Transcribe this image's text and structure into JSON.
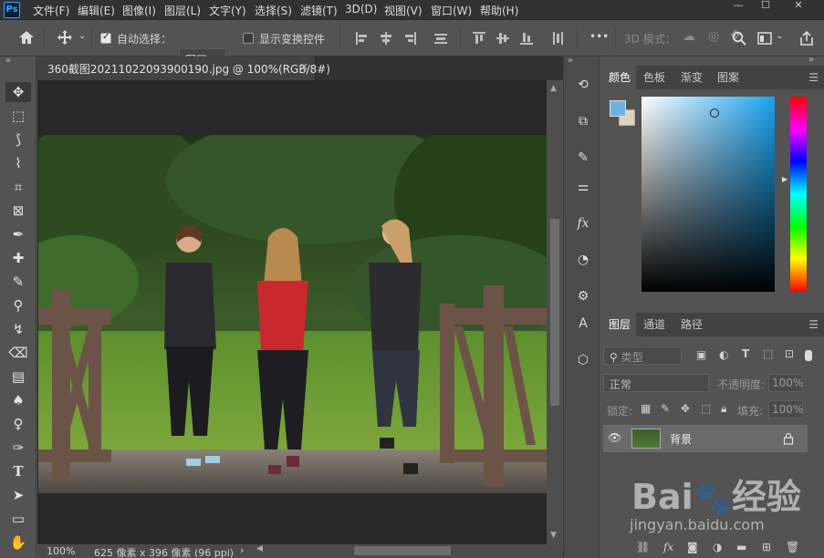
{
  "app": {
    "logo": "Ps"
  },
  "menu": [
    "文件(F)",
    "编辑(E)",
    "图像(I)",
    "图层(L)",
    "文字(Y)",
    "选择(S)",
    "滤镜(T)",
    "3D(D)",
    "视图(V)",
    "窗口(W)",
    "帮助(H)"
  ],
  "window_controls": {
    "minimize": "—",
    "maximize": "☐",
    "close": "✕"
  },
  "options": {
    "auto_select_label": "自动选择：",
    "auto_select_checked": true,
    "auto_select_target": "图层",
    "show_transform_label": "显示变换控件",
    "show_transform_checked": false,
    "more": "•••",
    "mode_3d_label": "3D 模式："
  },
  "document": {
    "tab_title": "360截图20211022093900190.jpg @ 100%(RGB/8#)",
    "close": "×"
  },
  "status": {
    "zoom": "100%",
    "info": "625 像素 x 396 像素 (96 ppi)",
    "arrow": "›"
  },
  "color_panel": {
    "tabs": [
      "颜色",
      "色板",
      "渐变",
      "图案"
    ],
    "active_tab": "颜色",
    "fg_color": "#6ab3e4",
    "bg_color": "#e0d3bc"
  },
  "layers_panel": {
    "tabs": [
      "图层",
      "通道",
      "路径"
    ],
    "active_tab": "图层",
    "filter_placeholder": "类型",
    "blend_mode": "正常",
    "opacity_label": "不透明度:",
    "opacity_value": "100%",
    "lock_label": "锁定:",
    "fill_label": "填充:",
    "fill_value": "100%",
    "layers": [
      {
        "name": "背景",
        "visible": true,
        "locked": true
      }
    ]
  },
  "watermark": {
    "brand": "Bai⬤百度 经验",
    "url": "jingyan.baidu.com"
  },
  "icons": {
    "home": "home-icon",
    "move": "move-icon",
    "lock": "lock-icon",
    "eye": "eye-icon"
  }
}
